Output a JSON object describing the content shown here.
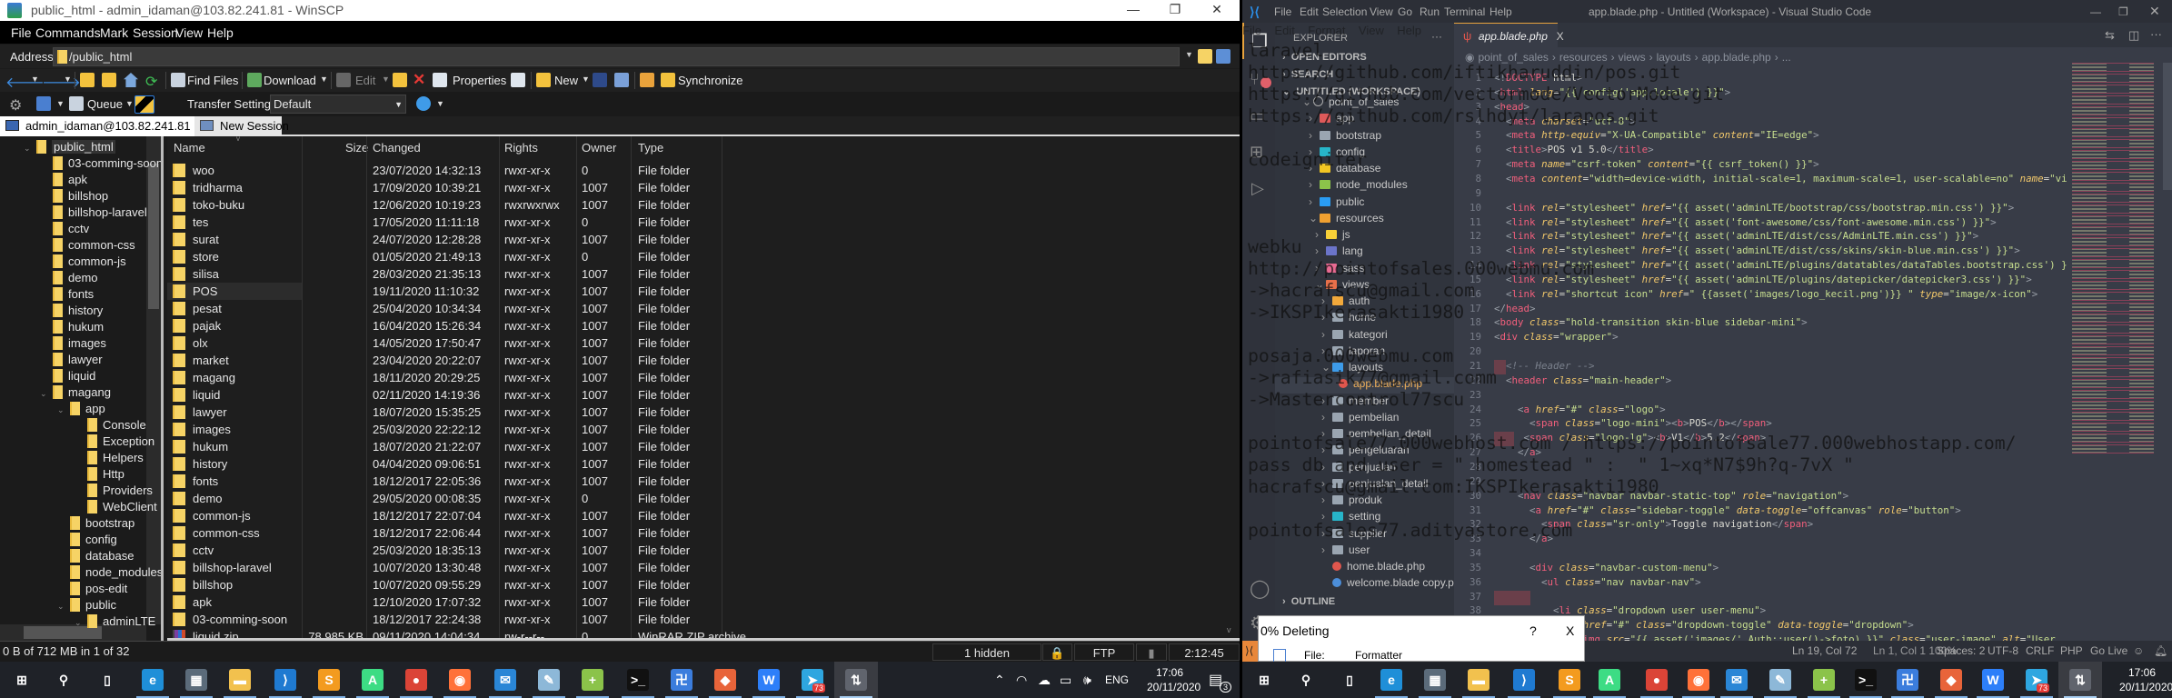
{
  "winscp": {
    "title": "public_html - admin_idaman@103.82.241.81 - WinSCP",
    "menu": [
      "File",
      "Commands",
      "Mark",
      "Session",
      "View",
      "Help"
    ],
    "address_label": "Address",
    "address_value": "/public_html",
    "toolbar": {
      "find_files": "Find Files",
      "download": "Download",
      "edit": "Edit",
      "properties": "Properties",
      "new": "New",
      "synchronize": "Synchronize"
    },
    "toolbar2": {
      "queue": "Queue",
      "transfer_settings": "Transfer Settings",
      "transfer_preset": "Default"
    },
    "tabs": {
      "session": "admin_idaman@103.82.241.81",
      "close": "X",
      "new_session": "New Session"
    },
    "tree": [
      {
        "label": "public_html",
        "level": 0,
        "expanded": true
      },
      {
        "label": "03-comming-soon",
        "level": 1
      },
      {
        "label": "apk",
        "level": 1
      },
      {
        "label": "billshop",
        "level": 1
      },
      {
        "label": "billshop-laravel",
        "level": 1
      },
      {
        "label": "cctv",
        "level": 1
      },
      {
        "label": "common-css",
        "level": 1
      },
      {
        "label": "common-js",
        "level": 1
      },
      {
        "label": "demo",
        "level": 1
      },
      {
        "label": "fonts",
        "level": 1
      },
      {
        "label": "history",
        "level": 1
      },
      {
        "label": "hukum",
        "level": 1
      },
      {
        "label": "images",
        "level": 1
      },
      {
        "label": "lawyer",
        "level": 1
      },
      {
        "label": "liquid",
        "level": 1
      },
      {
        "label": "magang",
        "level": 1,
        "expanded": true
      },
      {
        "label": "app",
        "level": 2,
        "expanded": true
      },
      {
        "label": "Console",
        "level": 3
      },
      {
        "label": "Exception",
        "level": 3
      },
      {
        "label": "Helpers",
        "level": 3
      },
      {
        "label": "Http",
        "level": 3
      },
      {
        "label": "Providers",
        "level": 3
      },
      {
        "label": "WebClient",
        "level": 3
      },
      {
        "label": "bootstrap",
        "level": 2
      },
      {
        "label": "config",
        "level": 2
      },
      {
        "label": "database",
        "level": 2
      },
      {
        "label": "node_modules",
        "level": 2
      },
      {
        "label": "pos-edit",
        "level": 2
      },
      {
        "label": "public",
        "level": 2,
        "expanded": true
      },
      {
        "label": "adminLTE",
        "level": 3,
        "expanded": true
      }
    ],
    "columns": [
      "Name",
      "Size",
      "Changed",
      "Rights",
      "Owner",
      "Type"
    ],
    "files": [
      [
        "woo",
        "",
        "23/07/2020 14:32:13",
        "rwxr-xr-x",
        "0",
        "File folder"
      ],
      [
        "tridharma",
        "",
        "17/09/2020 10:39:21",
        "rwxr-xr-x",
        "1007",
        "File folder"
      ],
      [
        "toko-buku",
        "",
        "12/06/2020 10:19:23",
        "rwxrwxrwx",
        "1007",
        "File folder"
      ],
      [
        "tes",
        "",
        "17/05/2020 11:11:18",
        "rwxr-xr-x",
        "0",
        "File folder"
      ],
      [
        "surat",
        "",
        "24/07/2020 12:28:28",
        "rwxr-xr-x",
        "1007",
        "File folder"
      ],
      [
        "store",
        "",
        "01/05/2020 21:49:13",
        "rwxr-xr-x",
        "0",
        "File folder"
      ],
      [
        "silisa",
        "",
        "28/03/2020 21:35:13",
        "rwxr-xr-x",
        "1007",
        "File folder"
      ],
      [
        "POS",
        "",
        "19/11/2020 11:10:32",
        "rwxr-xr-x",
        "1007",
        "File folder"
      ],
      [
        "pesat",
        "",
        "25/04/2020 10:34:34",
        "rwxr-xr-x",
        "1007",
        "File folder"
      ],
      [
        "pajak",
        "",
        "16/04/2020 15:26:34",
        "rwxr-xr-x",
        "1007",
        "File folder"
      ],
      [
        "olx",
        "",
        "14/05/2020 17:50:47",
        "rwxr-xr-x",
        "1007",
        "File folder"
      ],
      [
        "market",
        "",
        "23/04/2020 20:22:07",
        "rwxr-xr-x",
        "1007",
        "File folder"
      ],
      [
        "magang",
        "",
        "18/11/2020 20:29:25",
        "rwxr-xr-x",
        "1007",
        "File folder"
      ],
      [
        "liquid",
        "",
        "02/11/2020 14:19:36",
        "rwxr-xr-x",
        "1007",
        "File folder"
      ],
      [
        "lawyer",
        "",
        "18/07/2020 15:35:25",
        "rwxr-xr-x",
        "1007",
        "File folder"
      ],
      [
        "images",
        "",
        "25/03/2020 22:22:12",
        "rwxr-xr-x",
        "1007",
        "File folder"
      ],
      [
        "hukum",
        "",
        "18/07/2020 21:22:07",
        "rwxr-xr-x",
        "1007",
        "File folder"
      ],
      [
        "history",
        "",
        "04/04/2020 09:06:51",
        "rwxr-xr-x",
        "1007",
        "File folder"
      ],
      [
        "fonts",
        "",
        "18/12/2017 22:05:36",
        "rwxr-xr-x",
        "1007",
        "File folder"
      ],
      [
        "demo",
        "",
        "29/05/2020 00:08:35",
        "rwxr-xr-x",
        "0",
        "File folder"
      ],
      [
        "common-js",
        "",
        "18/12/2017 22:07:04",
        "rwxr-xr-x",
        "1007",
        "File folder"
      ],
      [
        "common-css",
        "",
        "18/12/2017 22:06:44",
        "rwxr-xr-x",
        "1007",
        "File folder"
      ],
      [
        "cctv",
        "",
        "25/03/2020 18:35:13",
        "rwxr-xr-x",
        "1007",
        "File folder"
      ],
      [
        "billshop-laravel",
        "",
        "10/07/2020 13:30:48",
        "rwxr-xr-x",
        "1007",
        "File folder"
      ],
      [
        "billshop",
        "",
        "10/07/2020 09:55:29",
        "rwxr-xr-x",
        "1007",
        "File folder"
      ],
      [
        "apk",
        "",
        "12/10/2020 17:07:32",
        "rwxr-xr-x",
        "1007",
        "File folder"
      ],
      [
        "03-comming-soon",
        "",
        "18/12/2017 22:24:38",
        "rwxr-xr-x",
        "1007",
        "File folder"
      ],
      [
        "liquid.zip",
        "78,985 KB",
        "09/11/2020 14:04:34",
        "rw-r--r--",
        "0",
        "WinRAR ZIP archive"
      ]
    ],
    "selected_file": "POS",
    "status": {
      "selection": "0 B of 712 MB in 1 of 32",
      "hidden": "1 hidden",
      "protocol": "FTP",
      "elapsed": "2:12:45"
    }
  },
  "vscode": {
    "menu": [
      "File",
      "Edit",
      "Selection",
      "View",
      "Go",
      "Run",
      "Terminal",
      "Help"
    ],
    "title": "app.blade.php - Untitled (Workspace) - Visual Studio Code",
    "explorer_title": "EXPLORER",
    "sections": {
      "open_editors": "OPEN EDITORS",
      "search": "SEARCH",
      "workspace": "UNTITLED (WORKSPACE)",
      "outline": "OUTLINE"
    },
    "tree": [
      {
        "label": "point_of_sales",
        "level": 1,
        "kind": "root"
      },
      {
        "label": "app",
        "level": 2,
        "kind": "folder",
        "color": "#e05a5a"
      },
      {
        "label": "bootstrap",
        "level": 2,
        "kind": "folder",
        "color": "#9aa5b1"
      },
      {
        "label": "config",
        "level": 2,
        "kind": "folder",
        "color": "#27b5c9"
      },
      {
        "label": "database",
        "level": 2,
        "kind": "folder",
        "color": "#f3c623"
      },
      {
        "label": "node_modules",
        "level": 2,
        "kind": "folder",
        "color": "#8bc34a"
      },
      {
        "label": "public",
        "level": 2,
        "kind": "folder",
        "color": "#2a9df4"
      },
      {
        "label": "resources",
        "level": 2,
        "kind": "folder-open",
        "color": "#f0a030"
      },
      {
        "label": "js",
        "level": 3,
        "kind": "folder",
        "color": "#f7d038"
      },
      {
        "label": "lang",
        "level": 3,
        "kind": "folder",
        "color": "#6b74c9"
      },
      {
        "label": "sass",
        "level": 3,
        "kind": "folder",
        "color": "#e86a92"
      },
      {
        "label": "views",
        "level": 3,
        "kind": "folder-open",
        "color": "#e8704a"
      },
      {
        "label": "auth",
        "level": 4,
        "kind": "folder",
        "color": "#f2a93b"
      },
      {
        "label": "home",
        "level": 4,
        "kind": "folder",
        "color": "#9aa5b1"
      },
      {
        "label": "kategori",
        "level": 4,
        "kind": "folder",
        "color": "#9aa5b1"
      },
      {
        "label": "laporan",
        "level": 4,
        "kind": "folder",
        "color": "#9aa5b1"
      },
      {
        "label": "layouts",
        "level": 4,
        "kind": "folder-open",
        "color": "#3d9be9"
      },
      {
        "label": "app.blade.php",
        "level": 5,
        "kind": "file",
        "color": "#e0564d"
      },
      {
        "label": "member",
        "level": 4,
        "kind": "folder",
        "color": "#9aa5b1"
      },
      {
        "label": "pembelian",
        "level": 4,
        "kind": "folder",
        "color": "#9aa5b1"
      },
      {
        "label": "pembelian_detail",
        "level": 4,
        "kind": "folder",
        "color": "#9aa5b1"
      },
      {
        "label": "pengeluaran",
        "level": 4,
        "kind": "folder",
        "color": "#9aa5b1"
      },
      {
        "label": "penjualan",
        "level": 4,
        "kind": "folder",
        "color": "#9aa5b1"
      },
      {
        "label": "penjualan_detail",
        "level": 4,
        "kind": "folder",
        "color": "#9aa5b1"
      },
      {
        "label": "produk",
        "level": 4,
        "kind": "folder",
        "color": "#9aa5b1"
      },
      {
        "label": "setting",
        "level": 4,
        "kind": "folder",
        "color": "#27b5c9"
      },
      {
        "label": "supplier",
        "level": 4,
        "kind": "folder",
        "color": "#9aa5b1"
      },
      {
        "label": "user",
        "level": 4,
        "kind": "folder",
        "color": "#9aa5b1"
      },
      {
        "label": "home.blade.php",
        "level": 4,
        "kind": "file",
        "color": "#e0564d"
      },
      {
        "label": "welcome.blade copy.php",
        "level": 4,
        "kind": "file",
        "color": "#4c8ed9"
      }
    ],
    "active_file": "app.blade.php",
    "tab": {
      "label": "app.blade.php",
      "close": "X"
    },
    "breadcrumb": [
      "point_of_sales",
      "resources",
      "views",
      "layouts",
      "app.blade.php",
      "..."
    ],
    "code": [
      "<!DOCTYPE html>",
      "<html lang=\"{{ config('app.locale') }}\">",
      "<head>",
      "  <meta charset=\"utf-8\">",
      "  <meta http-equiv=\"X-UA-Compatible\" content=\"IE=edge\">",
      "  <title>POS v1 5.0</title>",
      "  <meta name=\"csrf-token\" content=\"{{ csrf_token() }}\">",
      "  <meta content=\"width=device-width, initial-scale=1, maximum-scale=1, user-scalable=no\" name=\"vi",
      "",
      "  <link rel=\"stylesheet\" href=\"{{ asset('adminLTE/bootstrap/css/bootstrap.min.css') }}\">",
      "  <link rel=\"stylesheet\" href=\"{{ asset('font-awesome/css/font-awesome.min.css') }}\">",
      "  <link rel=\"stylesheet\" href=\"{{ asset('adminLTE/dist/css/AdminLTE.min.css') }}\">",
      "  <link rel=\"stylesheet\" href=\"{{ asset('adminLTE/dist/css/skins/skin-blue.min.css') }}\">",
      "  <link rel=\"stylesheet\" href=\"{{ asset('adminLTE/plugins/datatables/dataTables.bootstrap.css') }",
      "  <link rel=\"stylesheet\" href=\"{{ asset('adminLTE/plugins/datepicker/datepicker3.css') }}\">",
      "  <link rel=\"shortcut icon\" href=\" {{asset('images/logo_kecil.png')}} \" type=\"image/x-icon\">",
      "</head>",
      "<body class=\"hold-transition skin-blue sidebar-mini\">",
      "<div class=\"wrapper\">",
      "",
      "  <!-- Header -->",
      "  <header class=\"main-header\">",
      "",
      "    <a href=\"#\" class=\"logo\">",
      "      <span class=\"logo-mini\"><b>POS</b></span>",
      "     <span class=\"logo-lg\"><b>V1</b>5.2</span>",
      "    </a>",
      "",
      "",
      "    <nav class=\"navbar navbar-static-top\" role=\"navigation\">",
      "      <a href=\"#\" class=\"sidebar-toggle\" data-toggle=\"offcanvas\" role=\"button\">",
      "        <span class=\"sr-only\">Toggle navigation</span>",
      "      </a>",
      "",
      "      <div class=\"navbar-custom-menu\">",
      "        <ul class=\"nav navbar-nav\">",
      "",
      "          <li class=\"dropdown user user-menu\">",
      "            <a href=\"#\" class=\"dropdown-toggle\" data-toggle=\"dropdown\">",
      "              <img src=\"{{ asset('images/'.Auth::user()->foto) }}\" class=\"user-image\" alt=\"User"
    ],
    "status": {
      "position": "Ln 19, Col 72",
      "spaces": "Spaces: 2",
      "encoding": "UTF-8",
      "eol": "CRLF",
      "language": "PHP",
      "live": "Go Live"
    }
  },
  "notepad": {
    "menu": [
      "File",
      "Edit",
      "Format",
      "View",
      "Help"
    ],
    "lines": [
      "laravel",
      "https://github.com/iftikharuddin/pos.git",
      "https://github.com/vectormode/VectorMode.git",
      "https://github.com/rslhdyt/larapos.git",
      "",
      "codeigniter",
      "",
      "",
      "",
      "webku",
      "http://pointofsales.000webmu.com",
      "->hacrafscu@gmail.com",
      "->IKSPIkerasakti1980",
      "",
      "posaja.000webmu.com",
      "->rafiasik77@gmail.comm",
      "->Mastercontrol77scu",
      "",
      "pointofsale77.000webhost.com / https://pointofsale77.000webhostapp.com/",
      "pass db and user = \" homestead \" :  \" 1~xq*N7$9h?q-7vX \"",
      "hacrafscu@gmail.com:IKSPIkerasakti1980",
      "",
      "pointofsales77.adityastore.com"
    ],
    "status": "Ln 1, Col 1   100%"
  },
  "dialog": {
    "title": "0% Deleting",
    "help": "?",
    "close": "X",
    "file_label": "File:",
    "file_value": "Formatter"
  },
  "taskbar": {
    "apps": [
      {
        "name": "start",
        "glyph": "⊞",
        "color": "transparent"
      },
      {
        "name": "search",
        "glyph": "⚲",
        "color": "transparent"
      },
      {
        "name": "task-view",
        "glyph": "▯",
        "color": "transparent"
      },
      {
        "name": "edge",
        "glyph": "e",
        "color": "#1f8fd8"
      },
      {
        "name": "store",
        "glyph": "▦",
        "color": "#5b6b7a"
      },
      {
        "name": "file-explorer",
        "glyph": "▬",
        "color": "#f2c14e"
      },
      {
        "name": "vscode",
        "glyph": "⟩",
        "color": "#1f7ad1"
      },
      {
        "name": "sublime",
        "glyph": "S",
        "color": "#f39b1f"
      },
      {
        "name": "android-studio",
        "glyph": "A",
        "color": "#3ddc84"
      },
      {
        "name": "chrome",
        "glyph": "●",
        "color": "#db4437"
      },
      {
        "name": "firefox",
        "glyph": "◉",
        "color": "#ff7139"
      },
      {
        "name": "mail",
        "glyph": "✉",
        "color": "#2a86d6"
      },
      {
        "name": "notepad",
        "glyph": "✎",
        "color": "#8db8d8"
      },
      {
        "name": "notepad-plus-plus",
        "glyph": "+",
        "color": "#8bc34a"
      },
      {
        "name": "cmd",
        "glyph": ">_",
        "color": "#111"
      },
      {
        "name": "maze-app",
        "glyph": "卍",
        "color": "#3b7ddd"
      },
      {
        "name": "git",
        "glyph": "◆",
        "color": "#e8643a"
      },
      {
        "name": "wps",
        "glyph": "W",
        "color": "#2d7ff9"
      },
      {
        "name": "telegram",
        "glyph": "➤",
        "color": "#2ea6e0",
        "badge": "73"
      },
      {
        "name": "winscp",
        "glyph": "⇅",
        "color": "#4a4f59",
        "active": true
      }
    ],
    "language": "ENG",
    "time": "17:06",
    "date": "20/11/2020",
    "notifications": "3"
  }
}
